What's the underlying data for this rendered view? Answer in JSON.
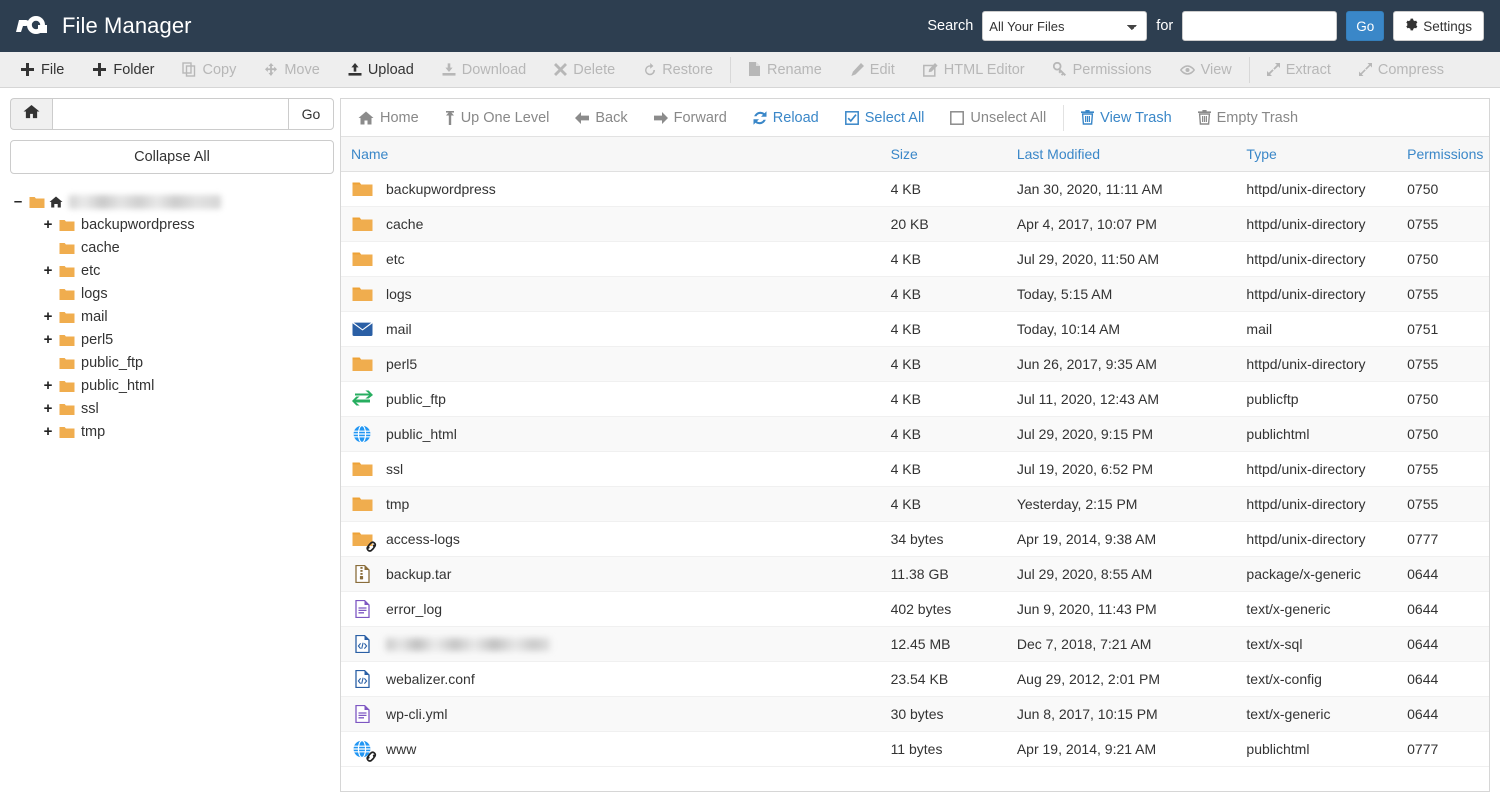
{
  "header": {
    "app_title": "File Manager",
    "logo": "cp-logo",
    "search_label": "Search",
    "search_scope_selected": "All Your Files",
    "search_scope_options": [
      "All Your Files"
    ],
    "for_label": "for",
    "search_value": "",
    "search_placeholder": "",
    "go_label": "Go",
    "settings_label": "Settings",
    "bg_color": "#2d3e50",
    "accent_color": "#3a87c8"
  },
  "toolbar": {
    "items": [
      {
        "label": "File",
        "icon": "plus-icon",
        "disabled": false
      },
      {
        "label": "Folder",
        "icon": "plus-icon",
        "disabled": false
      },
      {
        "label": "Copy",
        "icon": "copy-icon",
        "disabled": true
      },
      {
        "label": "Move",
        "icon": "move-icon",
        "disabled": true
      },
      {
        "label": "Upload",
        "icon": "upload-icon",
        "disabled": false
      },
      {
        "label": "Download",
        "icon": "download-icon",
        "disabled": true
      },
      {
        "label": "Delete",
        "icon": "delete-x-icon",
        "disabled": true
      },
      {
        "label": "Restore",
        "icon": "restore-icon",
        "disabled": true
      },
      {
        "label": "Rename",
        "icon": "rename-file-icon",
        "disabled": true,
        "divider_before": true
      },
      {
        "label": "Edit",
        "icon": "pencil-icon",
        "disabled": true
      },
      {
        "label": "HTML Editor",
        "icon": "html-editor-icon",
        "disabled": true
      },
      {
        "label": "Permissions",
        "icon": "key-icon",
        "disabled": true
      },
      {
        "label": "View",
        "icon": "eye-icon",
        "disabled": true
      },
      {
        "label": "Extract",
        "icon": "extract-icon",
        "disabled": true,
        "divider_before": true
      },
      {
        "label": "Compress",
        "icon": "compress-icon",
        "disabled": true
      }
    ]
  },
  "sidebar": {
    "path_value": "",
    "path_placeholder": "",
    "home_icon": "home-icon",
    "go_label": "Go",
    "collapse_all_label": "Collapse All",
    "tree": [
      {
        "label": "",
        "toggle": "-",
        "icon": "folder-open-icon",
        "extra_icon": "home-icon",
        "indent": 0,
        "redacted": true
      },
      {
        "label": "backupwordpress",
        "toggle": "+",
        "icon": "folder-icon",
        "indent": 1
      },
      {
        "label": "cache",
        "toggle": "",
        "icon": "folder-icon",
        "indent": 1
      },
      {
        "label": "etc",
        "toggle": "+",
        "icon": "folder-icon",
        "indent": 1
      },
      {
        "label": "logs",
        "toggle": "",
        "icon": "folder-icon",
        "indent": 1
      },
      {
        "label": "mail",
        "toggle": "+",
        "icon": "folder-icon",
        "indent": 1
      },
      {
        "label": "perl5",
        "toggle": "+",
        "icon": "folder-icon",
        "indent": 1
      },
      {
        "label": "public_ftp",
        "toggle": "",
        "icon": "folder-icon",
        "indent": 1
      },
      {
        "label": "public_html",
        "toggle": "+",
        "icon": "folder-icon",
        "indent": 1
      },
      {
        "label": "ssl",
        "toggle": "+",
        "icon": "folder-icon",
        "indent": 1
      },
      {
        "label": "tmp",
        "toggle": "+",
        "icon": "folder-icon",
        "indent": 1
      }
    ]
  },
  "navbar": {
    "items": [
      {
        "label": "Home",
        "icon": "home-icon",
        "style": "gray"
      },
      {
        "label": "Up One Level",
        "icon": "up-arrow-icon",
        "style": "gray"
      },
      {
        "label": "Back",
        "icon": "back-arrow-icon",
        "style": "gray"
      },
      {
        "label": "Forward",
        "icon": "forward-arrow-icon",
        "style": "gray"
      },
      {
        "label": "Reload",
        "icon": "reload-icon",
        "style": "blue"
      },
      {
        "label": "Select All",
        "icon": "checkbox-checked-icon",
        "style": "blue"
      },
      {
        "label": "Unselect All",
        "icon": "checkbox-empty-icon",
        "style": "gray"
      },
      {
        "label": "View Trash",
        "icon": "trash-icon",
        "style": "blue",
        "divider_before": true
      },
      {
        "label": "Empty Trash",
        "icon": "trash-icon",
        "style": "gray"
      }
    ]
  },
  "table": {
    "columns": [
      "Name",
      "Size",
      "Last Modified",
      "Type",
      "Permissions"
    ],
    "rows": [
      {
        "name": "backupwordpress",
        "icon": "folder-icon",
        "size": "4 KB",
        "modified": "Jan 30, 2020, 11:11 AM",
        "type": "httpd/unix-directory",
        "permissions": "0750"
      },
      {
        "name": "cache",
        "icon": "folder-icon",
        "size": "20 KB",
        "modified": "Apr 4, 2017, 10:07 PM",
        "type": "httpd/unix-directory",
        "permissions": "0755"
      },
      {
        "name": "etc",
        "icon": "folder-icon",
        "size": "4 KB",
        "modified": "Jul 29, 2020, 11:50 AM",
        "type": "httpd/unix-directory",
        "permissions": "0750"
      },
      {
        "name": "logs",
        "icon": "folder-icon",
        "size": "4 KB",
        "modified": "Today, 5:15 AM",
        "type": "httpd/unix-directory",
        "permissions": "0755"
      },
      {
        "name": "mail",
        "icon": "mail-envelope-icon",
        "size": "4 KB",
        "modified": "Today, 10:14 AM",
        "type": "mail",
        "permissions": "0751"
      },
      {
        "name": "perl5",
        "icon": "folder-icon",
        "size": "4 KB",
        "modified": "Jun 26, 2017, 9:35 AM",
        "type": "httpd/unix-directory",
        "permissions": "0755"
      },
      {
        "name": "public_ftp",
        "icon": "ftp-exchange-icon",
        "size": "4 KB",
        "modified": "Jul 11, 2020, 12:43 AM",
        "type": "publicftp",
        "permissions": "0750"
      },
      {
        "name": "public_html",
        "icon": "globe-icon",
        "size": "4 KB",
        "modified": "Jul 29, 2020, 9:15 PM",
        "type": "publichtml",
        "permissions": "0750"
      },
      {
        "name": "ssl",
        "icon": "folder-icon",
        "size": "4 KB",
        "modified": "Jul 19, 2020, 6:52 PM",
        "type": "httpd/unix-directory",
        "permissions": "0755"
      },
      {
        "name": "tmp",
        "icon": "folder-icon",
        "size": "4 KB",
        "modified": "Yesterday, 2:15 PM",
        "type": "httpd/unix-directory",
        "permissions": "0755"
      },
      {
        "name": "access-logs",
        "icon": "folder-icon",
        "symlink": true,
        "size": "34 bytes",
        "modified": "Apr 19, 2014, 9:38 AM",
        "type": "httpd/unix-directory",
        "permissions": "0777"
      },
      {
        "name": "backup.tar",
        "icon": "archive-file-icon",
        "size": "11.38 GB",
        "modified": "Jul 29, 2020, 8:55 AM",
        "type": "package/x-generic",
        "permissions": "0644"
      },
      {
        "name": "error_log",
        "icon": "text-file-icon",
        "size": "402 bytes",
        "modified": "Jun 9, 2020, 11:43 PM",
        "type": "text/x-generic",
        "permissions": "0644"
      },
      {
        "name": "",
        "icon": "code-file-icon",
        "redacted": true,
        "size": "12.45 MB",
        "modified": "Dec 7, 2018, 7:21 AM",
        "type": "text/x-sql",
        "permissions": "0644"
      },
      {
        "name": "webalizer.conf",
        "icon": "code-file-icon",
        "size": "23.54 KB",
        "modified": "Aug 29, 2012, 2:01 PM",
        "type": "text/x-config",
        "permissions": "0644"
      },
      {
        "name": "wp-cli.yml",
        "icon": "text-file-icon",
        "size": "30 bytes",
        "modified": "Jun 8, 2017, 10:15 PM",
        "type": "text/x-generic",
        "permissions": "0644"
      },
      {
        "name": "www",
        "icon": "globe-icon",
        "symlink": true,
        "size": "11 bytes",
        "modified": "Apr 19, 2014, 9:21 AM",
        "type": "publichtml",
        "permissions": "0777"
      }
    ]
  }
}
